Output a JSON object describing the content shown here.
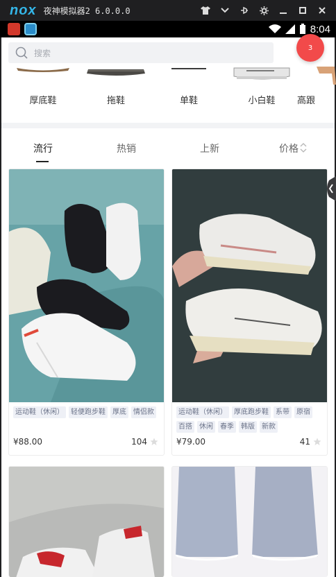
{
  "emulator": {
    "logo": "nox",
    "title": "夜神模拟器2 6.0.0.0",
    "controls": [
      "shirt-icon",
      "chevron-down-icon",
      "pin-icon",
      "gear-icon",
      "minimize-icon",
      "maximize-icon",
      "close-icon"
    ]
  },
  "status_bar": {
    "time": "8:04"
  },
  "search": {
    "placeholder": "搜索"
  },
  "cart_badge": "3",
  "categories": [
    "厚底鞋",
    "拖鞋",
    "单鞋",
    "小白鞋",
    "高跟"
  ],
  "tabs": [
    "流行",
    "热销",
    "上新",
    "价格"
  ],
  "products": [
    {
      "tags": [
        "运动鞋（休闲）",
        "轻便跑步鞋",
        "厚底",
        "情侣款"
      ],
      "price": "¥88.00",
      "likes": "104"
    },
    {
      "tags": [
        "运动鞋（休闲）",
        "厚底跑步鞋",
        "系带",
        "原宿",
        "百搭",
        "休闲",
        "春季",
        "韩版",
        "新款"
      ],
      "price": "¥79.00",
      "likes": "41"
    }
  ],
  "colors": {
    "accent_badge": "#f24a4a",
    "tag_bg": "#eef0f6",
    "tag_text": "#6a7288"
  }
}
